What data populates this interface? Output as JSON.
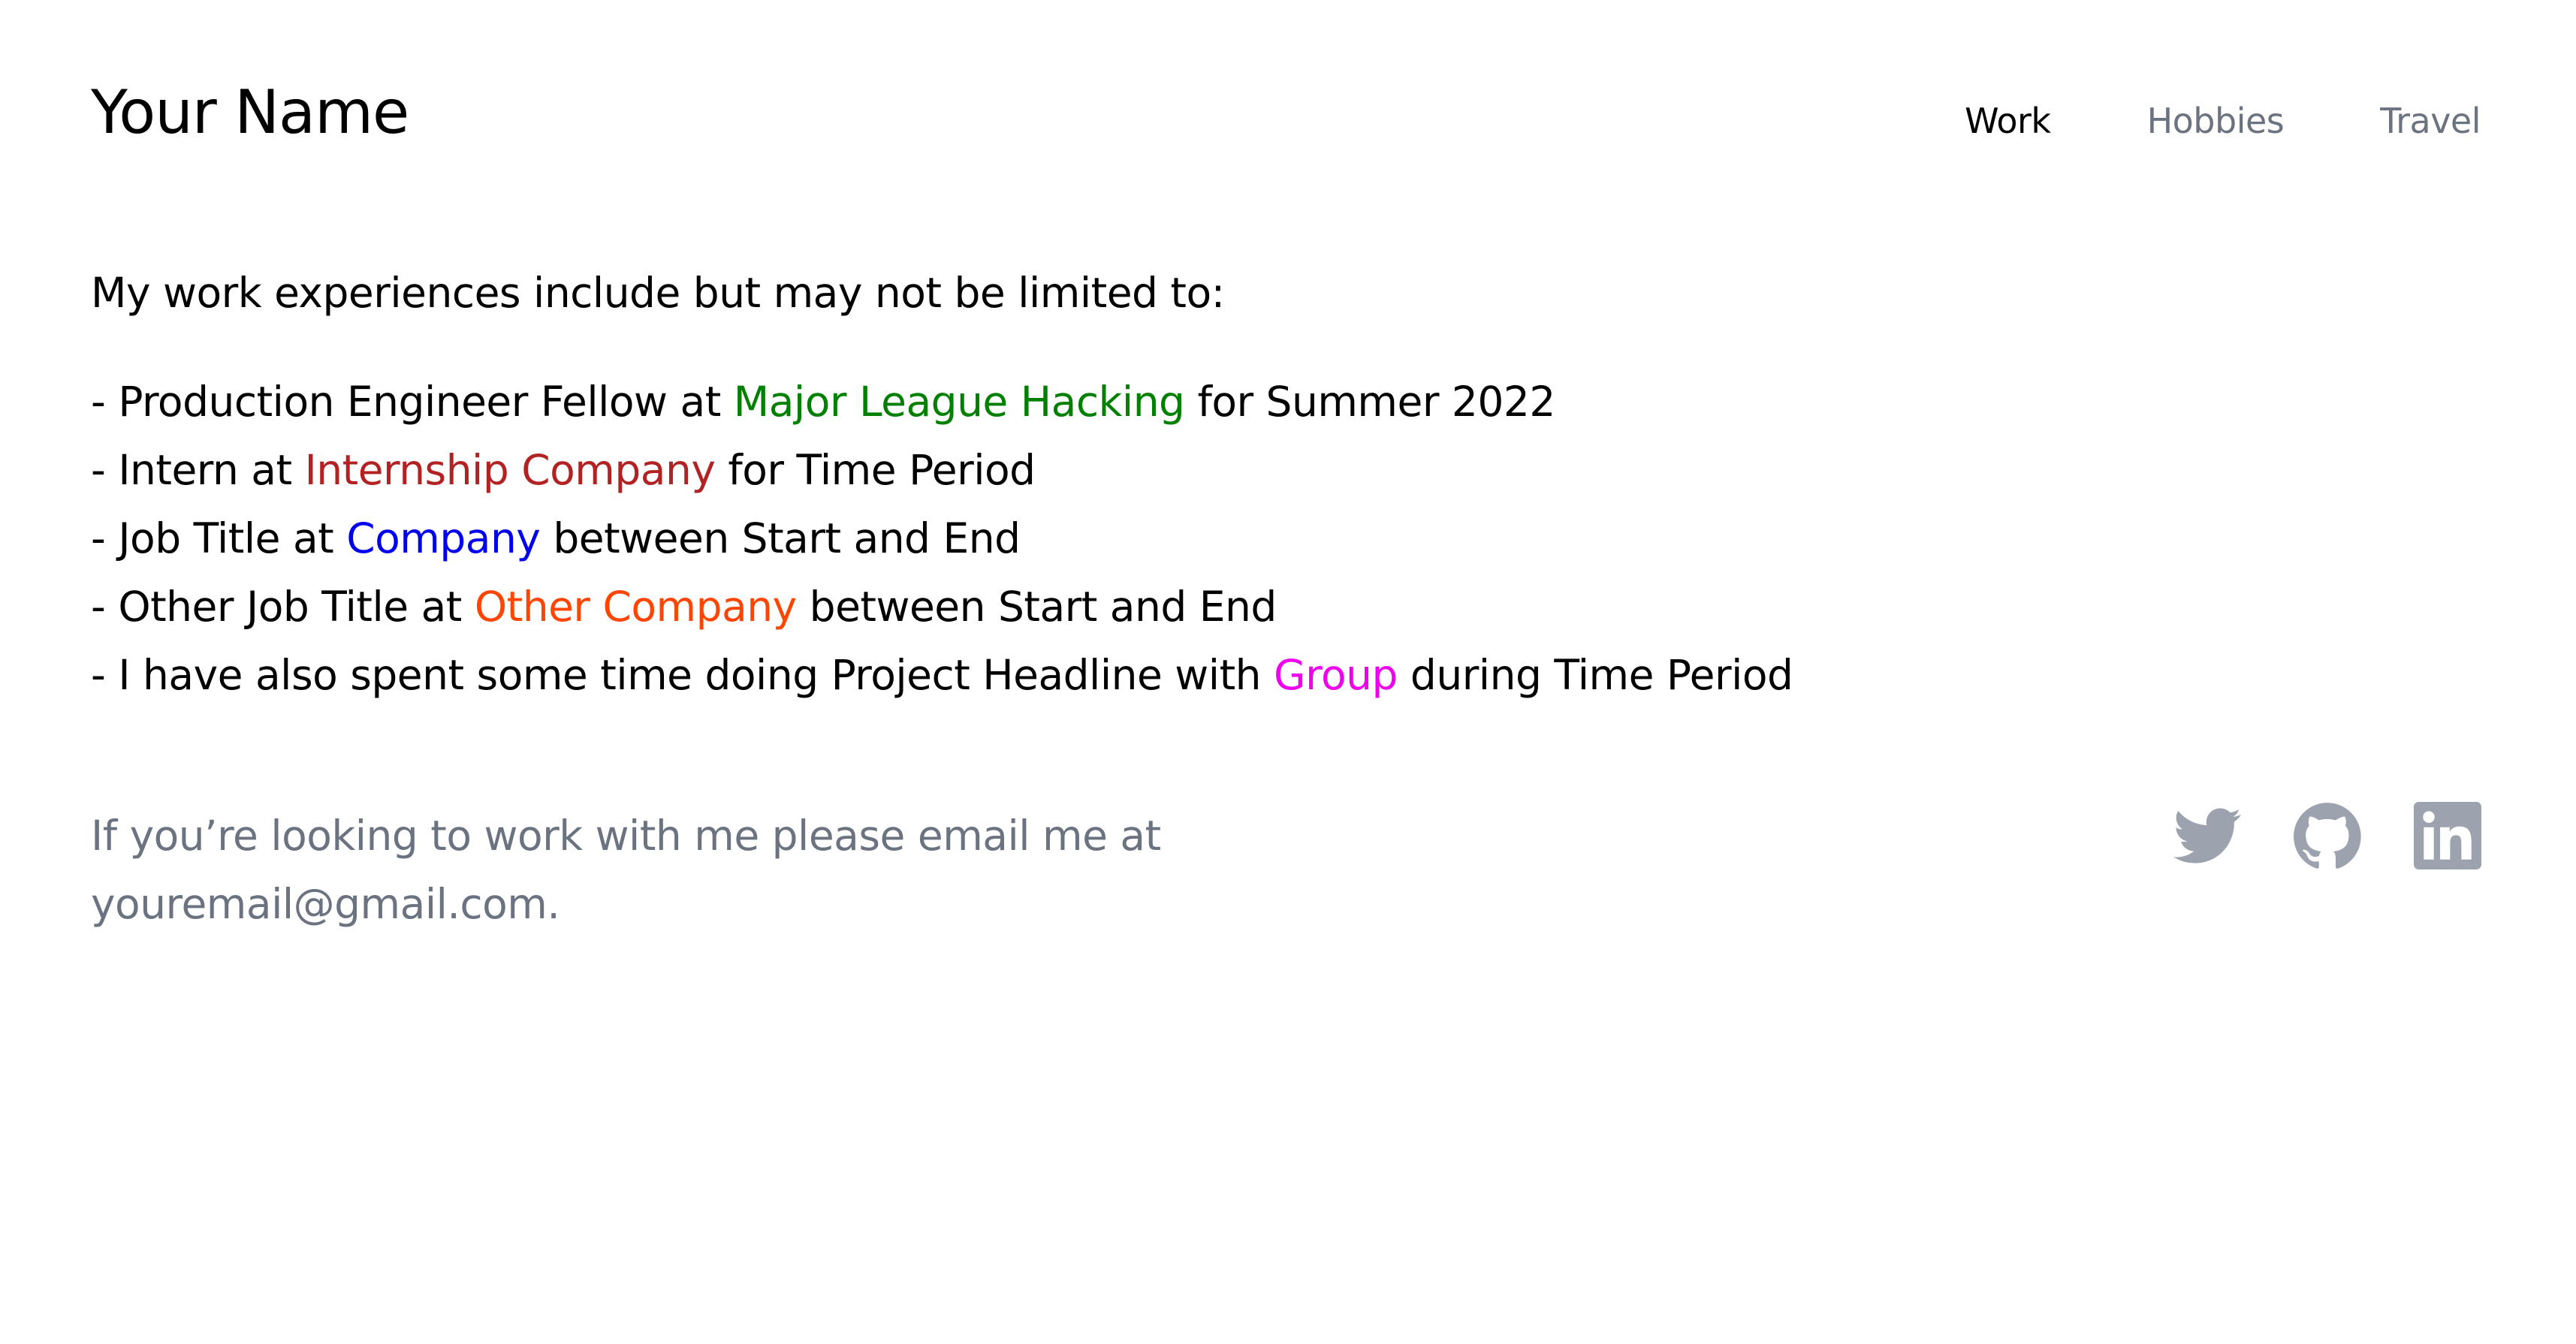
{
  "header": {
    "title": "Your Name",
    "nav": [
      {
        "label": "Work",
        "active": true
      },
      {
        "label": "Hobbies",
        "active": false
      },
      {
        "label": "Travel",
        "active": false
      }
    ]
  },
  "main": {
    "intro": "My work experiences include but may not be limited to:",
    "jobs": [
      {
        "before": "- Production Engineer Fellow at ",
        "org": "Major League Hacking",
        "org_color": "#008000",
        "after": " for Summer 2022"
      },
      {
        "before": "- Intern at ",
        "org": "Internship Company",
        "org_color": "#b22222",
        "after": " for Time Period"
      },
      {
        "before": "- Job Title at ",
        "org": "Company",
        "org_color": "#0000ee",
        "after": " between Start and End"
      },
      {
        "before": "- Other Job Title at ",
        "org": "Other Company",
        "org_color": "#ff4500",
        "after": " between Start and End"
      },
      {
        "before": "- I have also spent some time doing Project Headline with ",
        "org": "Group",
        "org_color": "#ee00ee",
        "after": " during Time Period"
      }
    ]
  },
  "footer": {
    "contact_text": "If you’re looking to work with me please email me at youremail@gmail.com.",
    "socials": [
      {
        "icon": "twitter-icon"
      },
      {
        "icon": "github-icon"
      },
      {
        "icon": "linkedin-icon"
      }
    ],
    "icon_color": "#9ca3af"
  }
}
